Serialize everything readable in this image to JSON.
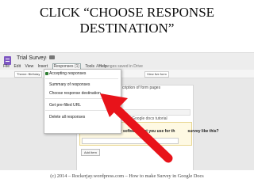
{
  "slide": {
    "title": "CLICK “CHOOSE RESPONSE\nDESTINATION”",
    "footer": "(c) 2014 – Rockerjay.wordpress.com – How to make Survey in Google Docs"
  },
  "app": {
    "doc_title": "Trial Survey",
    "status": "All changes saved in Drive"
  },
  "menubar": {
    "items": [
      "File",
      "Edit",
      "View",
      "Insert",
      "Responses (1)",
      "Tools",
      "Help"
    ]
  },
  "toolbar": {
    "theme_label": "Theme: Birthday",
    "view_live_form_label": "View live form"
  },
  "responses_menu": {
    "items": [
      "Accepting responses",
      "Summary of responses",
      "Choose response destination",
      "Get pre-filled URL",
      "Delete all responses"
    ]
  },
  "form": {
    "header_text": "cription of form pages",
    "question_hint": "rvey in Google docs tutorial",
    "question_label": "What are the apps or software that you use for th",
    "question_suffix": "survey like this?",
    "add_item_label": "Add item"
  },
  "colors": {
    "arrow": "#e8131a",
    "menu_check": "#2e7d32"
  },
  "icons": [
    "forms-logo-icon",
    "star-icon",
    "folder-icon",
    "red-arrow-icon"
  ]
}
